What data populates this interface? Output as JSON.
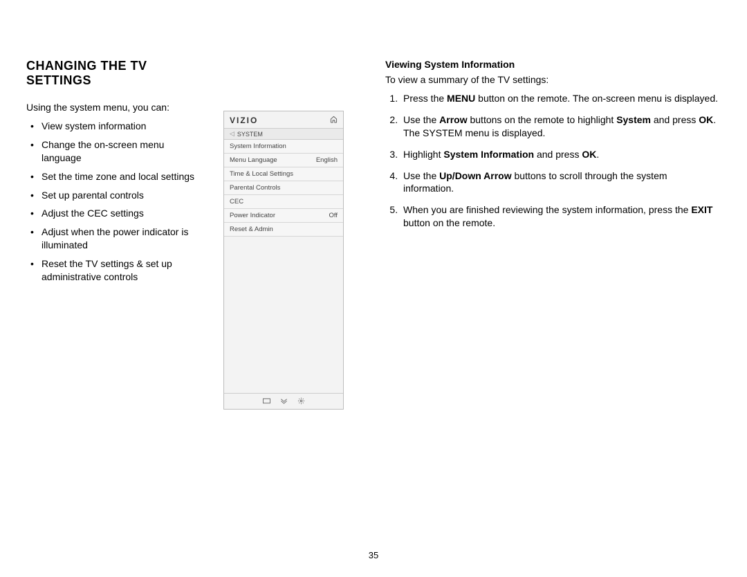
{
  "left": {
    "heading": "CHANGING THE TV SETTINGS",
    "intro": "Using the system menu, you can:",
    "bullets": [
      "View system information",
      "Change the on-screen menu language",
      "Set the time zone and local settings",
      "Set up parental controls",
      "Adjust the CEC settings",
      "Adjust when the power indicator is illuminated",
      "Reset the TV settings & set up administrative controls"
    ]
  },
  "tvmenu": {
    "logo": "VIZIO",
    "crumb": "SYSTEM",
    "rows": [
      {
        "label": "System Information",
        "value": ""
      },
      {
        "label": "Menu Language",
        "value": "English"
      },
      {
        "label": "Time & Local Settings",
        "value": ""
      },
      {
        "label": "Parental Controls",
        "value": ""
      },
      {
        "label": "CEC",
        "value": ""
      },
      {
        "label": "Power Indicator",
        "value": "Off"
      },
      {
        "label": "Reset & Admin",
        "value": ""
      }
    ]
  },
  "right": {
    "heading": "Viewing System Information",
    "intro": "To view a summary of the TV settings:",
    "steps": [
      {
        "pre": "Press the ",
        "bold1": "MENU",
        "mid1": " button on the remote. The on-screen menu is displayed.",
        "bold2": "",
        "mid2": "",
        "bold3": "",
        "tail": ""
      },
      {
        "pre": "Use the ",
        "bold1": "Arrow",
        "mid1": " buttons on the remote to highlight ",
        "bold2": "System",
        "mid2": " and press ",
        "bold3": "OK",
        "tail": ". The SYSTEM menu is displayed."
      },
      {
        "pre": "Highlight ",
        "bold1": "System Information",
        "mid1": " and press ",
        "bold2": "OK",
        "mid2": ".",
        "bold3": "",
        "tail": ""
      },
      {
        "pre": "Use the ",
        "bold1": "Up/Down Arrow",
        "mid1": " buttons to scroll through the system information.",
        "bold2": "",
        "mid2": "",
        "bold3": "",
        "tail": ""
      },
      {
        "pre": "When you are finished reviewing the system information, press the ",
        "bold1": "EXIT",
        "mid1": " button on the remote.",
        "bold2": "",
        "mid2": "",
        "bold3": "",
        "tail": ""
      }
    ]
  },
  "pageNumber": "35"
}
